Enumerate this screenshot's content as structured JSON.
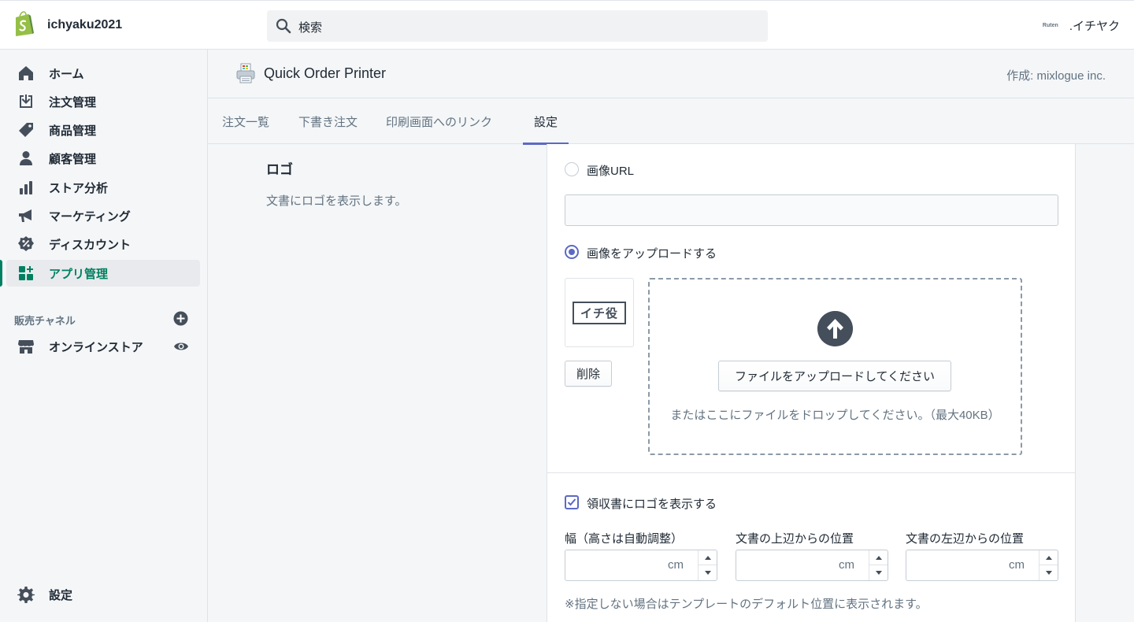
{
  "topbar": {
    "shop_name": "ichyaku2021",
    "search_placeholder": "検索",
    "account_badge": "Ruten",
    "account_name": ".イチヤク"
  },
  "sidebar": {
    "items": [
      {
        "label": "ホーム",
        "icon": "home-icon"
      },
      {
        "label": "注文管理",
        "icon": "orders-icon"
      },
      {
        "label": "商品管理",
        "icon": "tag-icon"
      },
      {
        "label": "顧客管理",
        "icon": "person-icon"
      },
      {
        "label": "ストア分析",
        "icon": "analytics-icon"
      },
      {
        "label": "マーケティング",
        "icon": "megaphone-icon"
      },
      {
        "label": "ディスカウント",
        "icon": "discount-icon"
      },
      {
        "label": "アプリ管理",
        "icon": "apps-icon",
        "active": true
      }
    ],
    "channels_label": "販売チャネル",
    "online_store_label": "オンラインストア",
    "settings_label": "設定"
  },
  "app": {
    "title": "Quick Order Printer",
    "author": "作成: mixlogue inc."
  },
  "tabs": [
    {
      "label": "注文一覧"
    },
    {
      "label": "下書き注文"
    },
    {
      "label": "印刷画面へのリンク"
    },
    {
      "label": "設定",
      "active": true
    }
  ],
  "section": {
    "title": "ロゴ",
    "description": "文書にロゴを表示します。"
  },
  "logo_form": {
    "radio_url_label": "画像URL",
    "url_value": "",
    "radio_upload_label": "画像をアップロードする",
    "thumb_text": "イチ役",
    "delete_label": "削除",
    "upload_button_label": "ファイルをアップロードしてください",
    "drop_hint": "またはここにファイルをドロップしてください。（最大40KB）",
    "show_on_receipt_label": "領収書にロゴを表示する",
    "width_label": "幅（高さは自動調整）",
    "top_label": "文書の上辺からの位置",
    "left_label": "文書の左辺からの位置",
    "unit": "cm",
    "help_text": "※指定しない場合はテンプレートのデフォルト位置に表示されます。"
  },
  "colors": {
    "accent": "#5c6ac4",
    "active_nav": "#008060"
  }
}
